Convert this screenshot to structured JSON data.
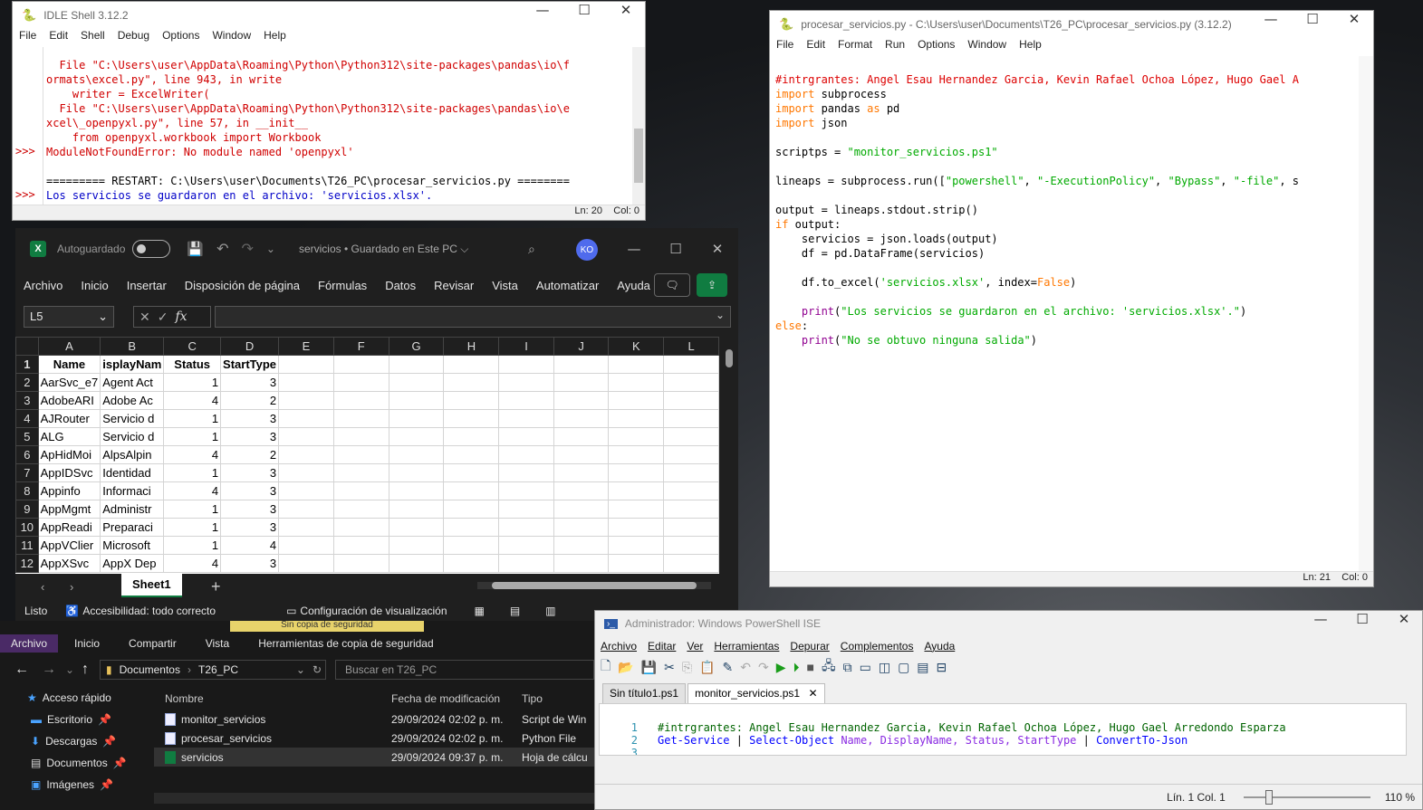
{
  "idle_shell": {
    "title": "IDLE Shell 3.12.2",
    "menu": [
      "File",
      "Edit",
      "Shell",
      "Debug",
      "Options",
      "Window",
      "Help"
    ],
    "prompt": ">>>",
    "lines": [
      "  File \"C:\\Users\\user\\AppData\\Roaming\\Python\\Python312\\site-packages\\pandas\\io\\f",
      "ormats\\excel.py\", line 943, in write",
      "    writer = ExcelWriter(",
      "  File \"C:\\Users\\user\\AppData\\Roaming\\Python\\Python312\\site-packages\\pandas\\io\\e",
      "xcel\\_openpyxl.py\", line 57, in __init__",
      "    from openpyxl.workbook import Workbook",
      "ModuleNotFoundError: No module named 'openpyxl'"
    ],
    "restart_line": "========= RESTART: C:\\Users\\user\\Documents\\T26_PC\\procesar_servicios.py ========",
    "output_line": "Los servicios se guardaron en el archivo: 'servicios.xlsx'.",
    "status": {
      "ln": "Ln: 20",
      "col": "Col: 0"
    }
  },
  "editor": {
    "title": "procesar_servicios.py - C:\\Users\\user\\Documents\\T26_PC\\procesar_servicios.py (3.12.2)",
    "menu": [
      "File",
      "Edit",
      "Format",
      "Run",
      "Options",
      "Window",
      "Help"
    ],
    "code": {
      "l1": "#intrgrantes: Angel Esau Hernandez Garcia, Kevin Rafael Ochoa López, Hugo Gael A",
      "import": "import",
      "as": "as",
      "if": "if",
      "else": "else",
      "mod_subprocess": " subprocess",
      "mod_pandas": " pandas ",
      "mod_pd": " pd",
      "mod_json": " json",
      "scriptps_a": "scriptps = ",
      "scriptps_b": "\"monitor_servicios.ps1\"",
      "lineaps_a": "lineaps = subprocess.run([",
      "s_powershell": "\"powershell\"",
      "s_exec": "\"-ExecutionPolicy\"",
      "s_bypass": "\"Bypass\"",
      "s_file": "\"-file\"",
      "lineaps_b": ", s",
      "sep": ", ",
      "output_line": "output = lineaps.stdout.strip()",
      "if_rest": " output:",
      "servicios_line": "    servicios = json.loads(output)",
      "df_line": "    df = pd.DataFrame(servicios)",
      "toexcel_a": "    df.to_excel(",
      "toexcel_b": "'servicios.xlsx'",
      "toexcel_c": ", index=",
      "false": "False",
      "close": ")",
      "print": "print",
      "indent": "    ",
      "print1_a": "(",
      "print1_s": "\"Los servicios se guardaron en el archivo: 'servicios.xlsx'.\"",
      "print2_s": "\"No se obtuvo ninguna salida\"",
      "else_rest": ":"
    },
    "status": {
      "ln": "Ln: 21",
      "col": "Col: 0"
    }
  },
  "excel": {
    "autosave_label": "Autoguardado",
    "file_title": "servicios • Guardado en Este PC ⌵",
    "avatar": "KO",
    "ribbon_tabs": [
      "Archivo",
      "Inicio",
      "Insertar",
      "Disposición de página",
      "Fórmulas",
      "Datos",
      "Revisar",
      "Vista",
      "Automatizar",
      "Ayuda"
    ],
    "name_box": "L5",
    "fx": "fx",
    "columns": [
      "A",
      "B",
      "C",
      "D",
      "E",
      "F",
      "G",
      "H",
      "I",
      "J",
      "K",
      "L"
    ],
    "header_row": [
      "Name",
      "isplayNam",
      "Status",
      "StartType"
    ],
    "rows": [
      [
        "AarSvc_e7",
        "Agent Act",
        "1",
        "3"
      ],
      [
        "AdobeARI",
        "Adobe Ac",
        "4",
        "2"
      ],
      [
        "AJRouter",
        "Servicio d",
        "1",
        "3"
      ],
      [
        "ALG",
        "Servicio d",
        "1",
        "3"
      ],
      [
        "ApHidMoi",
        "AlpsAlpin",
        "4",
        "2"
      ],
      [
        "AppIDSvc",
        "Identidad",
        "1",
        "3"
      ],
      [
        "Appinfo",
        "Informaci",
        "4",
        "3"
      ],
      [
        "AppMgmt",
        "Administr",
        "1",
        "3"
      ],
      [
        "AppReadi",
        "Preparaci",
        "1",
        "3"
      ],
      [
        "AppVClier",
        "Microsoft",
        "1",
        "4"
      ],
      [
        "AppXSvc",
        "AppX Dep",
        "4",
        "3"
      ]
    ],
    "sheet_tab": "Sheet1",
    "status_ready": "Listo",
    "accessibility": "Accesibilidad: todo correcto",
    "display_settings": "Configuración de visualización"
  },
  "explorer": {
    "tabs": [
      "Archivo",
      "Inicio",
      "Compartir",
      "Vista",
      "Herramientas de copia de seguridad"
    ],
    "banner": "Sin copia de seguridad",
    "path": [
      "Documentos",
      "T26_PC"
    ],
    "search_placeholder": "Buscar en T26_PC",
    "nav": [
      "Acceso rápido",
      "Escritorio",
      "Descargas",
      "Documentos",
      "Imágenes"
    ],
    "col_name": "Nombre",
    "col_date": "Fecha de modificación",
    "col_type": "Tipo",
    "files": [
      {
        "name": "monitor_servicios",
        "date": "29/09/2024 02:02 p. m.",
        "type": "Script de Win"
      },
      {
        "name": "procesar_servicios",
        "date": "29/09/2024 02:02 p. m.",
        "type": "Python File"
      },
      {
        "name": "servicios",
        "date": "29/09/2024 09:37 p. m.",
        "type": "Hoja de cálcu"
      }
    ]
  },
  "ise": {
    "title": "Administrador: Windows PowerShell ISE",
    "menu": [
      "Archivo",
      "Editar",
      "Ver",
      "Herramientas",
      "Depurar",
      "Complementos",
      "Ayuda"
    ],
    "tabs": [
      "Sin título1.ps1",
      "monitor_servicios.ps1"
    ],
    "code": {
      "n1": "1",
      "n2": "2",
      "n3": "3",
      "l1": "#intrgrantes: Angel Esau Hernandez Garcia, Kevin Rafael Ochoa López, Hugo Gael Arredondo Esparza",
      "cmd1": "Get-Service",
      "pipe": " | ",
      "cmd2": "Select-Object",
      "args": " Name, DisplayName, Status, StartType",
      "cmd3": "ConvertTo-Json"
    },
    "status_pos": "Lín. 1  Col. 1",
    "zoom": "110 %"
  }
}
